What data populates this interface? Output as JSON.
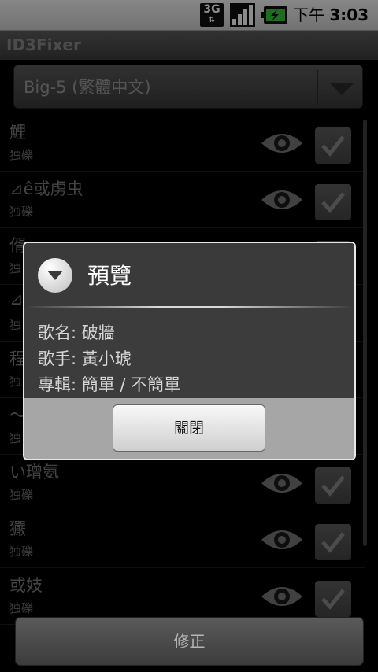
{
  "status_bar": {
    "network": "3G",
    "time_prefix": "下午",
    "time": "3:03"
  },
  "app": {
    "title": "ID3Fixer"
  },
  "encoding_spinner": {
    "selected": "Big-5 (繁體中文)"
  },
  "list": {
    "rows": [
      {
        "title": "鯉",
        "subtitle": "独礫"
      },
      {
        "title": "⊿ê或虏虫",
        "subtitle": "独礫"
      },
      {
        "title": "偦",
        "subtitle": "独"
      },
      {
        "title": "⊿",
        "subtitle": "独"
      },
      {
        "title": "程",
        "subtitle": "独"
      },
      {
        "title": "〜",
        "subtitle": "独"
      },
      {
        "title": "い璔氨",
        "subtitle": "独礫"
      },
      {
        "title": "玁",
        "subtitle": "独礫"
      },
      {
        "title": "或妓",
        "subtitle": "独礫"
      }
    ]
  },
  "preview_dialog": {
    "title": "預覽",
    "song_line": "歌名: 破牆",
    "artist_line": "歌手: 黃小琥",
    "album_line": "專輯: 簡單 / 不簡單",
    "close_label": "關閉"
  },
  "fix_button": {
    "label": "修正"
  }
}
